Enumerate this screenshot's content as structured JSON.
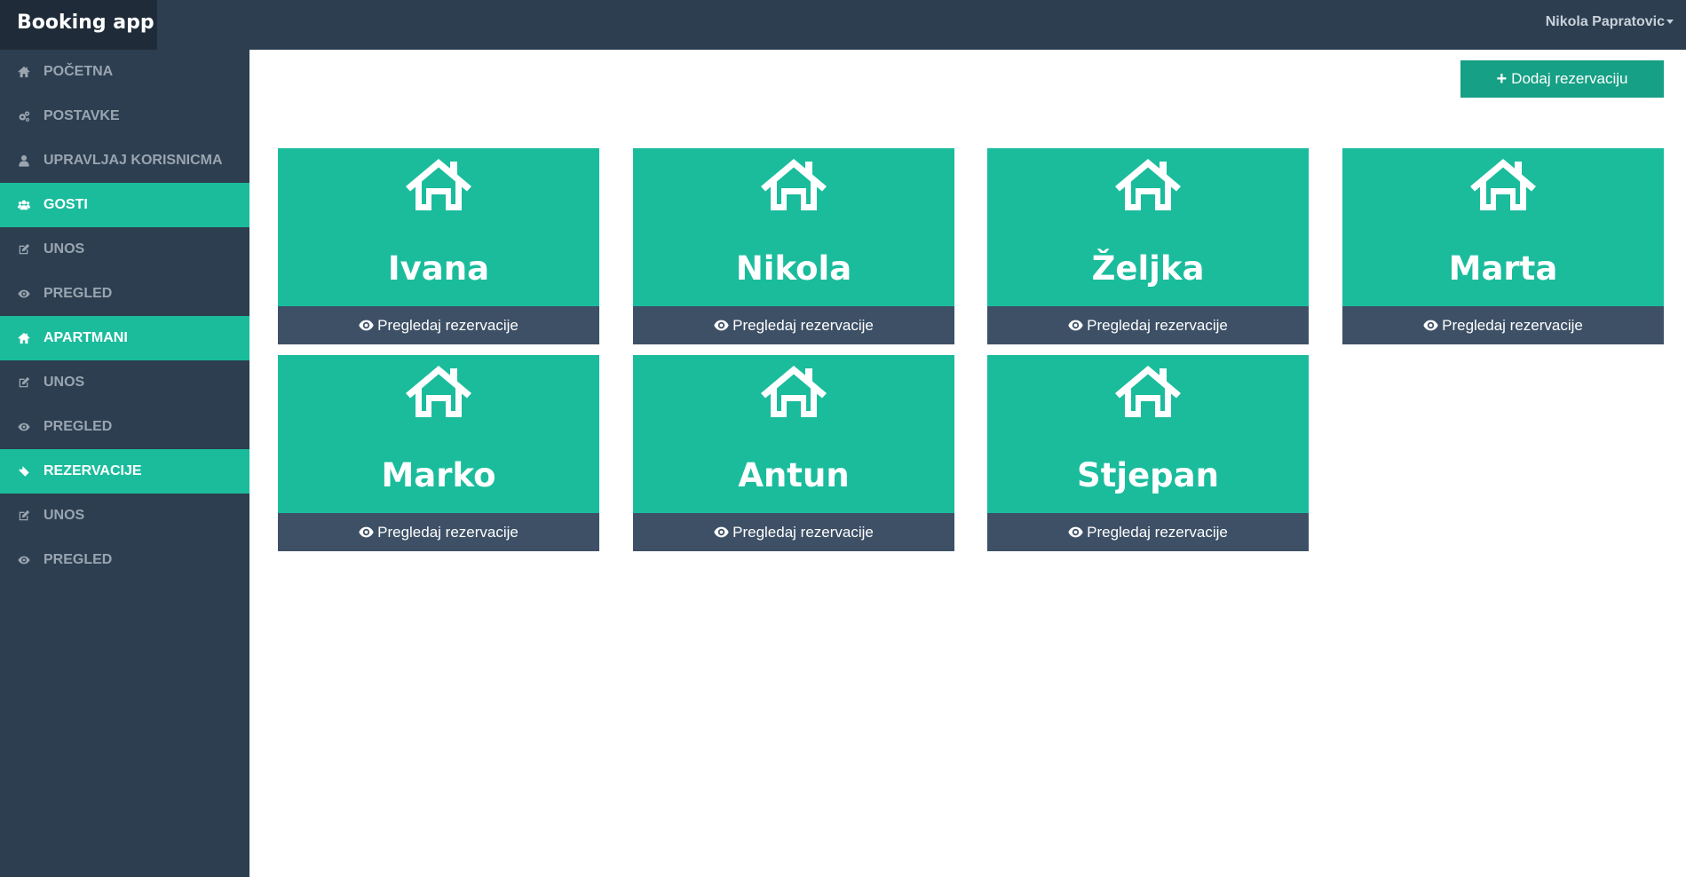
{
  "app": {
    "brand": "Booking app",
    "user_name": "Nikola Papratovic"
  },
  "sidebar": {
    "items": [
      {
        "label": "POČETNA",
        "icon": "home-icon",
        "active": false
      },
      {
        "label": "POSTAVKE",
        "icon": "cogs-icon",
        "active": false
      },
      {
        "label": "UPRAVLJAJ KORISNICMA",
        "icon": "user-icon",
        "active": false
      },
      {
        "label": "GOSTI",
        "icon": "users-icon",
        "active": true
      },
      {
        "label": "UNOS",
        "icon": "edit-icon",
        "active": false
      },
      {
        "label": "PREGLED",
        "icon": "eye-icon",
        "active": false
      },
      {
        "label": "APARTMANI",
        "icon": "home-icon",
        "active": true
      },
      {
        "label": "UNOS",
        "icon": "edit-icon",
        "active": false
      },
      {
        "label": "PREGLED",
        "icon": "eye-icon",
        "active": false
      },
      {
        "label": "REZERVACIJE",
        "icon": "ticket-icon",
        "active": true
      },
      {
        "label": "UNOS",
        "icon": "edit-icon",
        "active": false
      },
      {
        "label": "PREGLED",
        "icon": "eye-icon",
        "active": false
      }
    ]
  },
  "main": {
    "add_button_label": "Dodaj rezervaciju",
    "cards": [
      {
        "name": "Ivana",
        "action": "Pregledaj rezervacije"
      },
      {
        "name": "Nikola",
        "action": "Pregledaj rezervacije"
      },
      {
        "name": "Željka",
        "action": "Pregledaj rezervacije"
      },
      {
        "name": "Marta",
        "action": "Pregledaj rezervacije"
      },
      {
        "name": "Marko",
        "action": "Pregledaj rezervacije"
      },
      {
        "name": "Antun",
        "action": "Pregledaj rezervacije"
      },
      {
        "name": "Stjepan",
        "action": "Pregledaj rezervacije"
      }
    ]
  },
  "colors": {
    "topbar": "#2c3e50",
    "brand_bg": "#1f2b38",
    "accent": "#1abc9c",
    "button": "#16a085",
    "card_footer": "#3d5066"
  }
}
